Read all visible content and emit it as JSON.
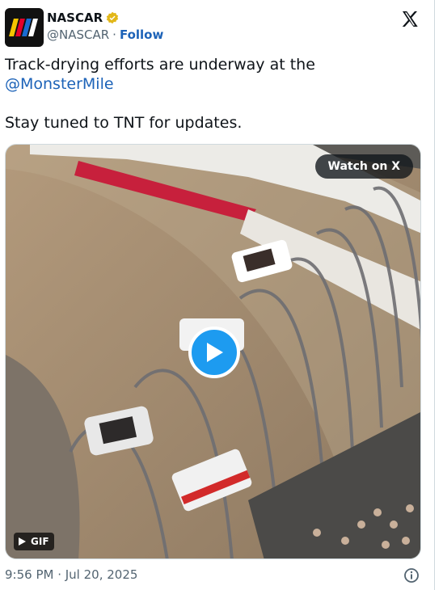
{
  "author": {
    "display_name": "NASCAR",
    "handle": "@NASCAR",
    "separator": "·",
    "follow_label": "Follow",
    "avatar_icon": "nascar-logo",
    "verified_icon": "verified-badge-icon",
    "verified_color": "#e2b719"
  },
  "post": {
    "line1": "Track-drying efforts are underway at the",
    "mention": "@MonsterMile",
    "line2": "Stay tuned to TNT for updates."
  },
  "media": {
    "watch_label": "Watch on X",
    "gif_label": "GIF",
    "play_icon": "play-icon"
  },
  "footer": {
    "timestamp": "9:56 PM · Jul 20, 2025",
    "info_icon": "info-icon"
  },
  "colors": {
    "link": "#1d63b8",
    "play_button": "#1d9bf0",
    "text": "#0f1419",
    "muted": "#536471"
  }
}
